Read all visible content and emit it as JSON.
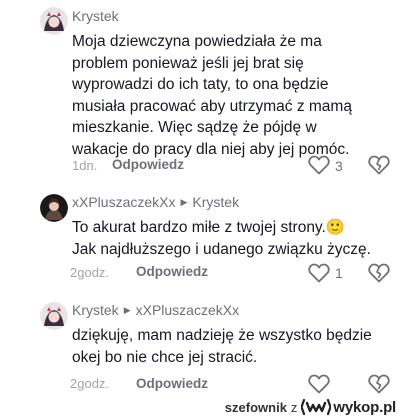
{
  "comments": [
    {
      "author": "Krystek",
      "lines": [
        "Moja dziewczyna powiedziała że ma",
        "problem ponieważ jeśli jej brat się",
        "wyprowadzi do ich taty, to ona będzie",
        "musiała pracować aby utrzymać z mamą",
        "mieszkanie. Więc sądzę że pójdę w",
        "wakacje do pracy dla niej aby jej pomóc."
      ],
      "time": "1dn.",
      "reply_label": "Odpowiedz",
      "likes": "3"
    },
    {
      "author": "xXPluszaczekXx",
      "reply_to": "Krystek",
      "lines": [
        "To akurat bardzo miłe z twojej strony.🙂",
        "Jak najdłuższego i udanego związku życzę."
      ],
      "time": "2godz.",
      "reply_label": "Odpowiedz",
      "likes": "1"
    },
    {
      "author": "Krystek",
      "reply_to": "xXPluszaczekXx",
      "lines": [
        "dziękuję, mam nadzieję że wszystko będzie",
        "okej bo nie chce jej stracić."
      ],
      "time": "2godz.",
      "reply_label": "Odpowiedz"
    }
  ],
  "watermark": {
    "user": "szefownik",
    "connector": "z",
    "site": "wykop.pl"
  },
  "icons": {
    "like": "heart-outline-icon",
    "dislike": "broken-heart-outline-icon",
    "reply_arrow": "triangle-right-icon"
  },
  "colors": {
    "username": "#6f7077",
    "body_text": "#161823",
    "meta": "#a3a4a9",
    "icon": "#6f7077"
  }
}
